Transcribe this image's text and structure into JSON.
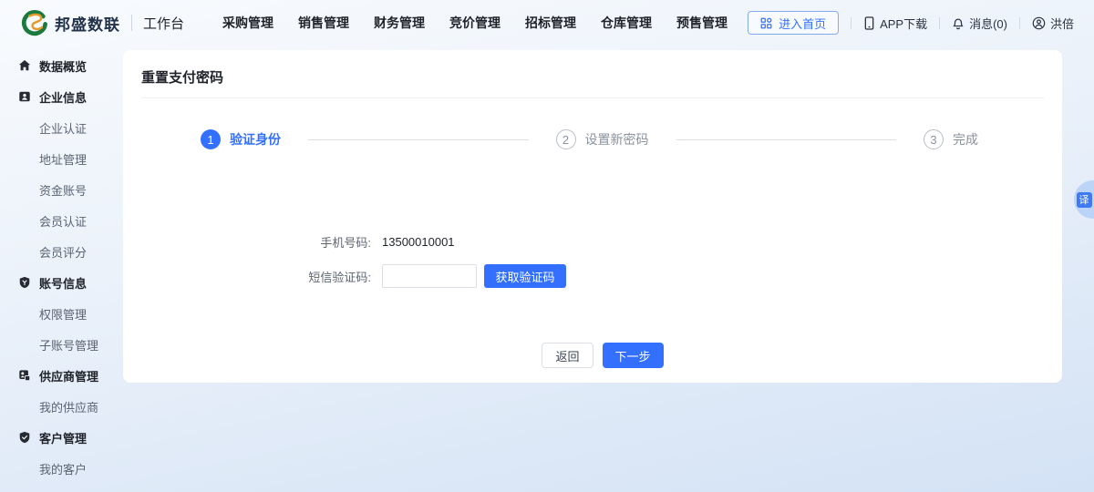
{
  "brand": {
    "name": "邦盛数联",
    "workspace": "工作台"
  },
  "header": {
    "nav": [
      "采购管理",
      "销售管理",
      "财务管理",
      "竞价管理",
      "招标管理",
      "仓库管理",
      "预售管理"
    ],
    "enter_home": "进入首页",
    "app_download": "APP下载",
    "messages": "消息(0)",
    "username": "洪倍"
  },
  "sidebar": {
    "groups": [
      {
        "label": "数据概览",
        "items": []
      },
      {
        "label": "企业信息",
        "items": [
          "企业认证",
          "地址管理",
          "资金账号",
          "会员认证",
          "会员评分"
        ]
      },
      {
        "label": "账号信息",
        "items": [
          "权限管理",
          "子账号管理"
        ]
      },
      {
        "label": "供应商管理",
        "items": [
          "我的供应商"
        ]
      },
      {
        "label": "客户管理",
        "items": [
          "我的客户"
        ]
      }
    ]
  },
  "main": {
    "title": "重置支付密码",
    "steps": [
      {
        "number": "1",
        "label": "验证身份",
        "state": "active"
      },
      {
        "number": "2",
        "label": "设置新密码",
        "state": "pending"
      },
      {
        "number": "3",
        "label": "完成",
        "state": "pending"
      }
    ],
    "form": {
      "phone_label": "手机号码:",
      "phone_value": "13500010001",
      "sms_label": "短信验证码:",
      "sms_value": "",
      "get_code_button": "获取验证码"
    },
    "buttons": {
      "back": "返回",
      "next": "下一步"
    }
  },
  "translate_widget": {
    "label": "译"
  },
  "colors": {
    "accent": "#3370ff",
    "brand_green": "#1b7a3e",
    "brand_orange": "#e59b2c"
  }
}
